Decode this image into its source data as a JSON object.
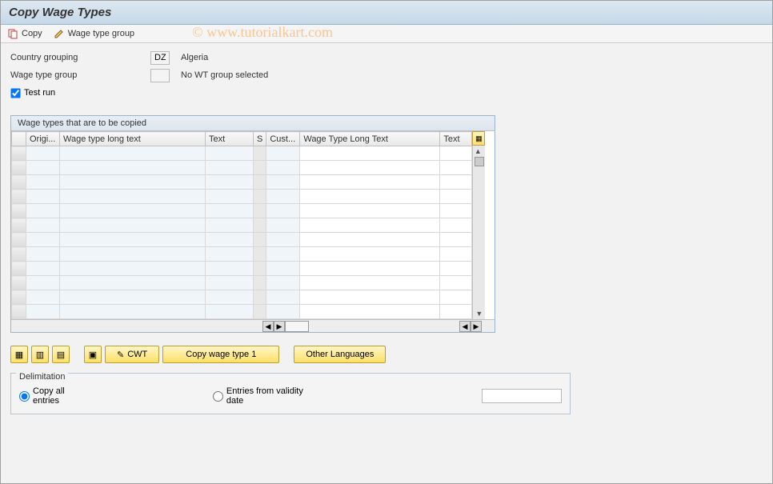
{
  "watermark": "© www.tutorialkart.com",
  "title": "Copy Wage Types",
  "toolbar": {
    "copy_label": "Copy",
    "wage_group_label": "Wage type group"
  },
  "form": {
    "country_label": "Country grouping",
    "country_value": "DZ",
    "country_desc": "Algeria",
    "wage_group_label": "Wage type group",
    "wage_group_value": "",
    "wage_group_desc": "No WT group selected",
    "test_run_label": "Test run"
  },
  "grid": {
    "title": "Wage types that are to be copied",
    "cols": {
      "origi": "Origi...",
      "wtlt1": "Wage type long text",
      "text1": "Text",
      "s": "S",
      "cust": "Cust...",
      "wtlt2": "Wage Type Long Text",
      "text2": "Text"
    }
  },
  "buttons": {
    "cwt": "CWT",
    "copy_wage_type_1": "Copy wage type 1",
    "other_languages": "Other Languages"
  },
  "delimitation": {
    "legend": "Delimitation",
    "copy_all": "Copy all entries",
    "entries_from": "Entries from validity date",
    "date_value": ""
  }
}
